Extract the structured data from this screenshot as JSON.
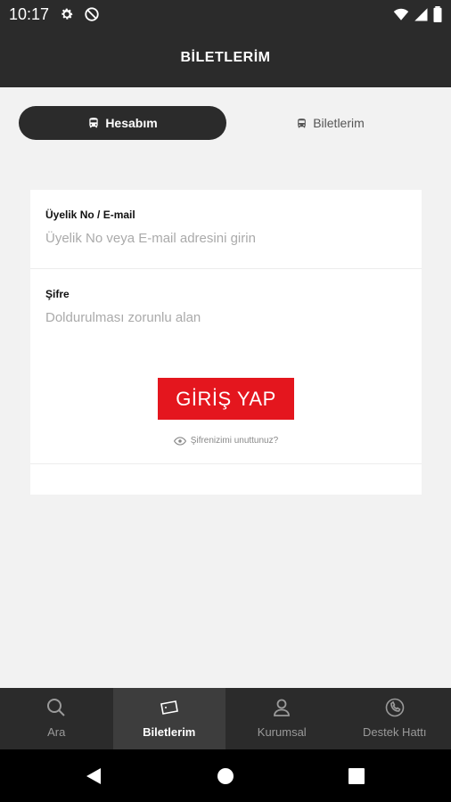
{
  "status_bar": {
    "time": "10:17"
  },
  "header": {
    "title": "BİLETLERİM"
  },
  "segment": {
    "active_label": "Hesabım",
    "inactive_label": "Biletlerim"
  },
  "form": {
    "member_label": "Üyelik No / E-mail",
    "member_placeholder": "Üyelik No veya E-mail adresini girin",
    "password_label": "Şifre",
    "password_placeholder": "Doldurulması zorunlu alan",
    "login_button": "GİRİŞ YAP",
    "forgot_password": "Şifrenizimi unuttunuz?"
  },
  "bottom_nav": {
    "items": [
      {
        "label": "Ara",
        "icon": "search-icon"
      },
      {
        "label": "Biletlerim",
        "icon": "ticket-icon"
      },
      {
        "label": "Kurumsal",
        "icon": "person-icon"
      },
      {
        "label": "Destek Hattı",
        "icon": "support-phone-icon"
      }
    ]
  },
  "colors": {
    "dark": "#2b2b2b",
    "accent": "#e4161e",
    "background": "#f2f2f2"
  }
}
